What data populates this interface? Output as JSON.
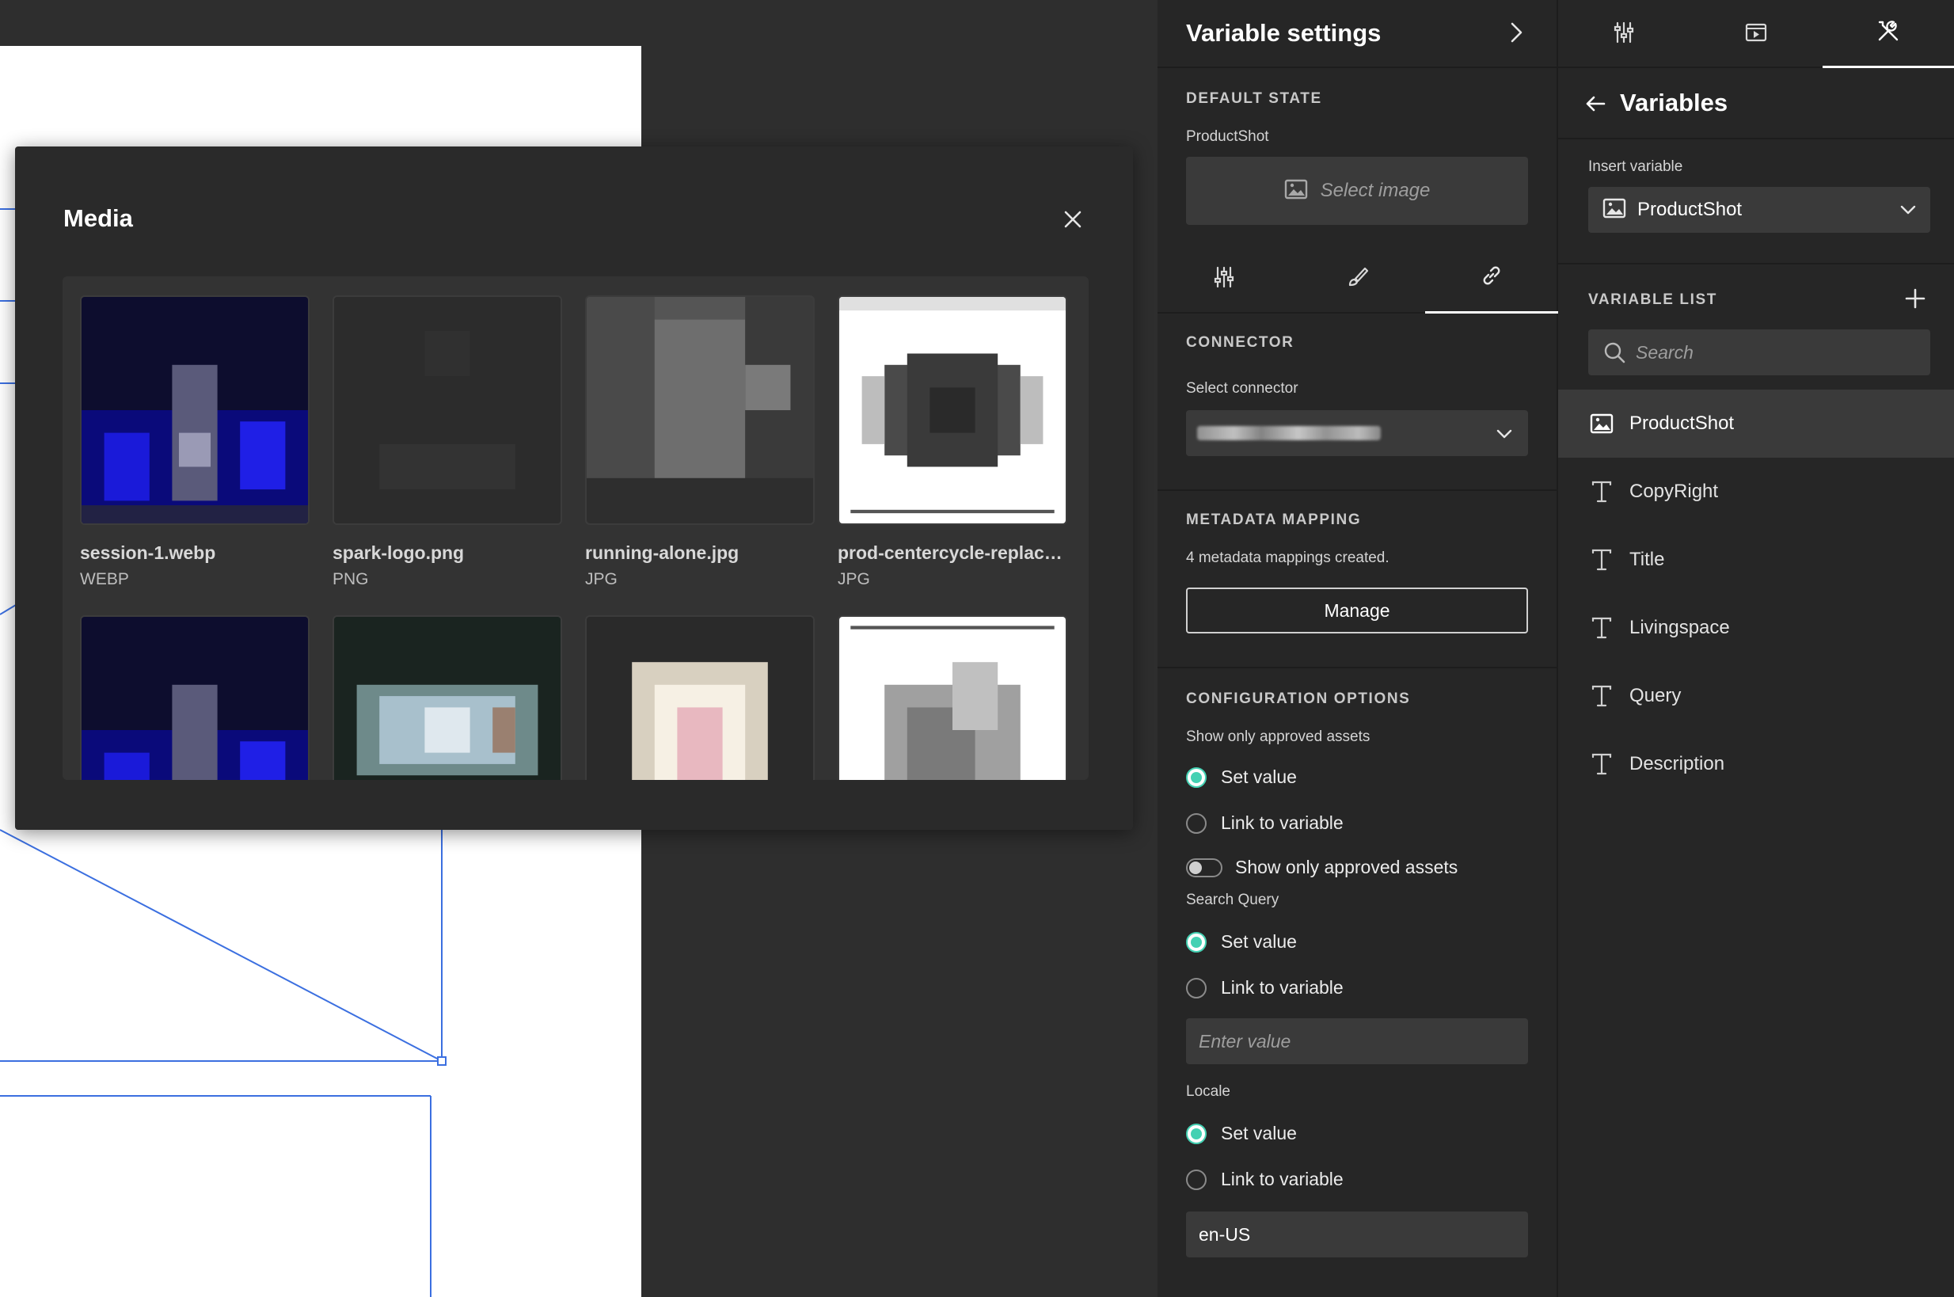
{
  "media_modal": {
    "title": "Media",
    "items": [
      {
        "name": "session-1.webp",
        "type": "WEBP"
      },
      {
        "name": "spark-logo.png",
        "type": "PNG"
      },
      {
        "name": "running-alone.jpg",
        "type": "JPG"
      },
      {
        "name": "prod-centercycle-replace...",
        "type": "JPG"
      },
      {
        "name": "",
        "type": ""
      },
      {
        "name": "",
        "type": ""
      },
      {
        "name": "",
        "type": ""
      },
      {
        "name": "",
        "type": ""
      }
    ]
  },
  "variable_settings": {
    "title": "Variable settings",
    "default_state_heading": "DEFAULT STATE",
    "default_state_label": "ProductShot",
    "select_image_label": "Select image",
    "connector_heading": "CONNECTOR",
    "select_connector_label": "Select connector",
    "metadata_heading": "METADATA MAPPING",
    "metadata_text": "4 metadata mappings created.",
    "manage_label": "Manage",
    "config_heading": "CONFIGURATION OPTIONS",
    "approved_label": "Show only approved assets",
    "set_value": "Set value",
    "link_to_variable": "Link to variable",
    "toggle_label": "Show only approved assets",
    "search_query_label": "Search Query",
    "enter_value_placeholder": "Enter value",
    "locale_label": "Locale",
    "locale_value": "en-US"
  },
  "variables_panel": {
    "title": "Variables",
    "insert_label": "Insert variable",
    "insert_value": "ProductShot",
    "list_heading": "VARIABLE LIST",
    "search_placeholder": "Search",
    "items": [
      {
        "label": "ProductShot",
        "icon": "image-icon",
        "selected": true
      },
      {
        "label": "CopyRight",
        "icon": "text-icon"
      },
      {
        "label": "Title",
        "icon": "text-icon"
      },
      {
        "label": "Livingspace",
        "icon": "text-icon"
      },
      {
        "label": "Query",
        "icon": "text-icon"
      },
      {
        "label": "Description",
        "icon": "text-icon"
      }
    ]
  },
  "colors": {
    "accent": "#44d1b3",
    "panel_bg": "#262626",
    "canvas_bg": "#2e2e2e",
    "guide_line": "#3b6fe0"
  }
}
